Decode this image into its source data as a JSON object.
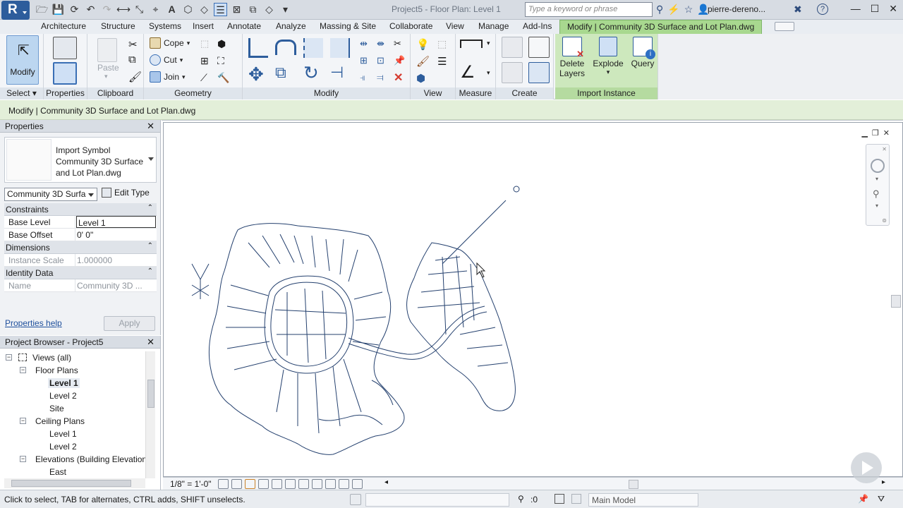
{
  "title_bar": {
    "app_letter": "R",
    "document_title": "Project5 - Floor Plan: Level 1",
    "search_placeholder": "Type a keyword or phrase",
    "user_name": "pierre-dereno...",
    "help_label": "?"
  },
  "ribbon_tabs": [
    "Architecture",
    "Structure",
    "Systems",
    "Insert",
    "Annotate",
    "Analyze",
    "Massing & Site",
    "Collaborate",
    "View",
    "Manage",
    "Add-Ins"
  ],
  "active_tab": "Modify | Community 3D Surface and Lot Plan.dwg",
  "ribbon": {
    "modify_label": "Modify",
    "paste_label": "Paste",
    "cope_label": "Cope",
    "cut_label": "Cut",
    "join_label": "Join",
    "delete_layers_label": "Delete Layers",
    "delete_label_line1": "Delete",
    "delete_label_line2": "Layers",
    "explode_label": "Explode",
    "query_label": "Query",
    "panels": {
      "select": "Select",
      "properties": "Properties",
      "clipboard": "Clipboard",
      "geometry": "Geometry",
      "modify": "Modify",
      "view": "View",
      "measure": "Measure",
      "create": "Create",
      "import_instance": "Import Instance"
    }
  },
  "options_bar": {
    "context_text": "Modify | Community 3D Surface and Lot Plan.dwg"
  },
  "properties": {
    "header": "Properties",
    "type_name_line1": "Import Symbol",
    "type_name_line2": "Community 3D Surface",
    "type_name_line3": "and Lot Plan.dwg",
    "instance_selector": "Community 3D Surfa",
    "edit_type_label": "Edit Type",
    "categories": {
      "constraints": "Constraints",
      "dimensions": "Dimensions",
      "identity": "Identity Data"
    },
    "rows": {
      "base_level_key": "Base Level",
      "base_level_val": "Level 1",
      "base_offset_key": "Base Offset",
      "base_offset_val": "0'  0\"",
      "instance_scale_key": "Instance Scale",
      "instance_scale_val": "1.000000",
      "name_key": "Name",
      "name_val": "Community 3D ..."
    },
    "help_link": "Properties help",
    "apply_label": "Apply"
  },
  "project_browser": {
    "header": "Project Browser - Project5",
    "items": [
      {
        "label": "Views (all)",
        "level": 0,
        "toggle": "-"
      },
      {
        "label": "Floor Plans",
        "level": 1,
        "toggle": "-"
      },
      {
        "label": "Level 1",
        "level": 2,
        "selected": true
      },
      {
        "label": "Level 2",
        "level": 2
      },
      {
        "label": "Site",
        "level": 2
      },
      {
        "label": "Ceiling Plans",
        "level": 1,
        "toggle": "-"
      },
      {
        "label": "Level 1",
        "level": 2
      },
      {
        "label": "Level 2",
        "level": 2
      },
      {
        "label": "Elevations (Building Elevation",
        "level": 1,
        "toggle": "-"
      },
      {
        "label": "East",
        "level": 2
      }
    ]
  },
  "canvas": {
    "view_scale": "1/8\" = 1'-0\"",
    "line_color": "#24406e"
  },
  "status_bar": {
    "hint": "Click to select, TAB for alternates, CTRL adds, SHIFT unselects.",
    "selection_count": ":0",
    "model_selector": "Main Model"
  }
}
